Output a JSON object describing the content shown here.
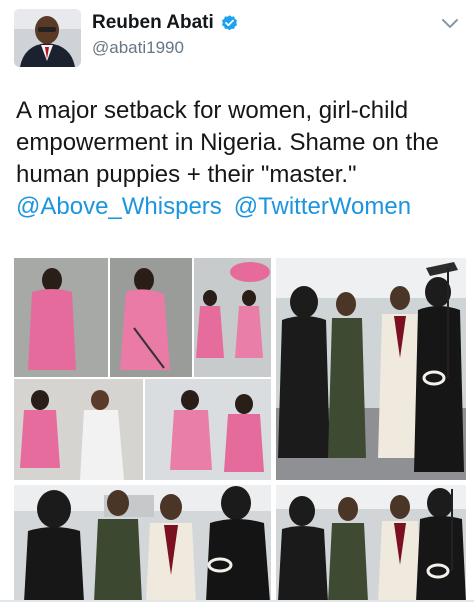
{
  "tweet": {
    "author": {
      "display_name": "Reuben Abati",
      "handle": "@abati1990",
      "verified": true,
      "avatar_icon": "user-photo"
    },
    "text_lines": [
      "A major setback for women, girl-child",
      "empowerment in Nigeria. Shame on the",
      "human puppies + their \"master.\""
    ],
    "mentions": [
      "@Above_Whispers",
      "@TwitterWomen"
    ],
    "media_count": 4
  },
  "colors": {
    "accent": "#1b95e0",
    "verified_badge": "#1da1f2",
    "text": "#14171a",
    "secondary_text": "#657786"
  }
}
